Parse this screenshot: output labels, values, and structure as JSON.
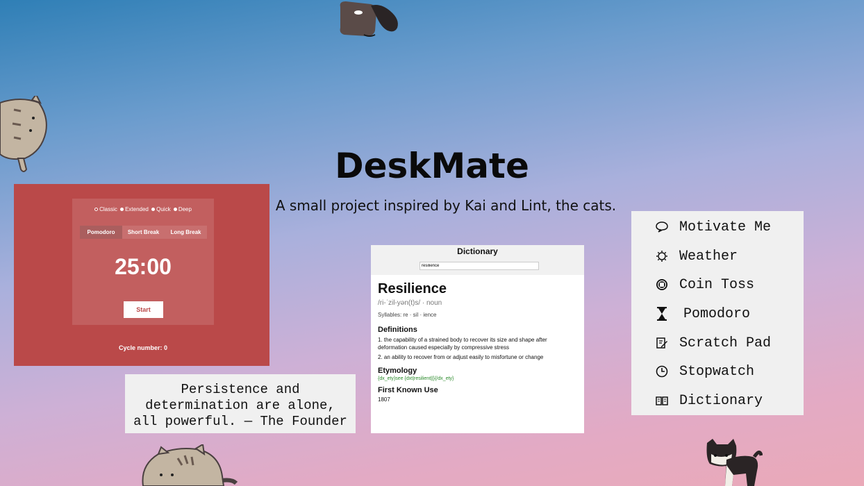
{
  "header": {
    "title": "DeskMate",
    "subtitle": "A small project inspired by Kai and Lint, the cats."
  },
  "pomodoro": {
    "presets": [
      "Classic",
      "Extended",
      "Quick",
      "Deep"
    ],
    "selected_preset": "Classic",
    "tabs": [
      "Pomodoro",
      "Short Break",
      "Long Break"
    ],
    "active_tab": "Pomodoro",
    "timer": "25:00",
    "start_label": "Start",
    "cycle_text": "Cycle number: 0",
    "colors": {
      "background": "#ba4949"
    }
  },
  "quote": {
    "lines": [
      "Persistence and",
      "determination are alone,",
      "all powerful. — The Founder"
    ]
  },
  "dictionary": {
    "title": "Dictionary",
    "search_value": "resilience",
    "word": "Resilience",
    "pronunciation": "/ri-ˈzil-yən(t)s/ · noun",
    "syllables": "Syllables: re · sil · ience",
    "definitions_heading": "Definitions",
    "definitions": [
      "1. the capability of a strained body to recover its size and shape after deformation caused especially by compressive stress",
      "2. an ability to recover from or adjust easily to misfortune or change"
    ],
    "etymology_heading": "Etymology",
    "etymology": "{dx_ety}see {dxt|resilient||}{/dx_ety}",
    "first_use_heading": "First Known Use",
    "first_use": "1807"
  },
  "menu": {
    "items": [
      {
        "label": "Motivate Me",
        "icon": "speech-bubble-icon"
      },
      {
        "label": "Weather",
        "icon": "sun-icon"
      },
      {
        "label": "Coin Toss",
        "icon": "coin-icon"
      },
      {
        "label": "Pomodoro",
        "icon": "hourglass-icon"
      },
      {
        "label": "Scratch Pad",
        "icon": "edit-note-icon"
      },
      {
        "label": "Stopwatch",
        "icon": "clock-icon"
      },
      {
        "label": "Dictionary",
        "icon": "book-icon"
      }
    ]
  }
}
